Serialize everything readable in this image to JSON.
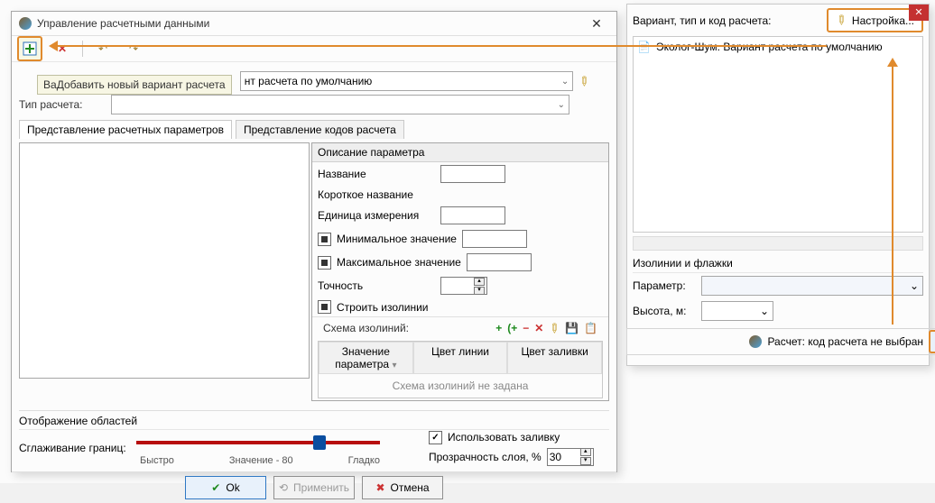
{
  "dialog": {
    "title": "Управление расчетными данными",
    "tooltip": "Добавить новый вариант расчета",
    "variant_prefix": "Ва",
    "variant_dd": "нт расчета по умолчанию",
    "type_label": "Тип расчета:",
    "tabs": {
      "params": "Представление расчетных параметров",
      "codes": "Представление кодов расчета"
    },
    "param": {
      "header": "Описание параметра",
      "name": "Название",
      "short": "Короткое название",
      "unit": "Единица измерения",
      "min": "Минимальное значение",
      "max": "Максимальное значение",
      "prec": "Точность",
      "iso": "Строить изолинии"
    },
    "iso_label": "Схема изолиний:",
    "table": {
      "c1": "Значение параметра",
      "c2": "Цвет линии",
      "c3": "Цвет заливки",
      "empty": "Схема изолиний не задана"
    },
    "areas": {
      "title": "Отображение областей",
      "smoothing": "Сглаживание границ:",
      "fast": "Быстро",
      "value": "Значение - 80",
      "smooth": "Гладко",
      "fill": "Использовать заливку",
      "opacity": "Прозрачность слоя, %",
      "opacity_val": "30"
    },
    "buttons": {
      "ok": "Ok",
      "apply": "Применить",
      "cancel": "Отмена"
    }
  },
  "panel": {
    "header": "Вариант, тип и код расчета:",
    "settings": "Настройка...",
    "list_item": "Эколог-Шум. Вариант расчета по умолчанию",
    "iso_section": "Изолинии и флажки",
    "param_label": "Параметр:",
    "height_label": "Высота, м:",
    "calc_label": "Расчет: код расчета не выбран"
  }
}
